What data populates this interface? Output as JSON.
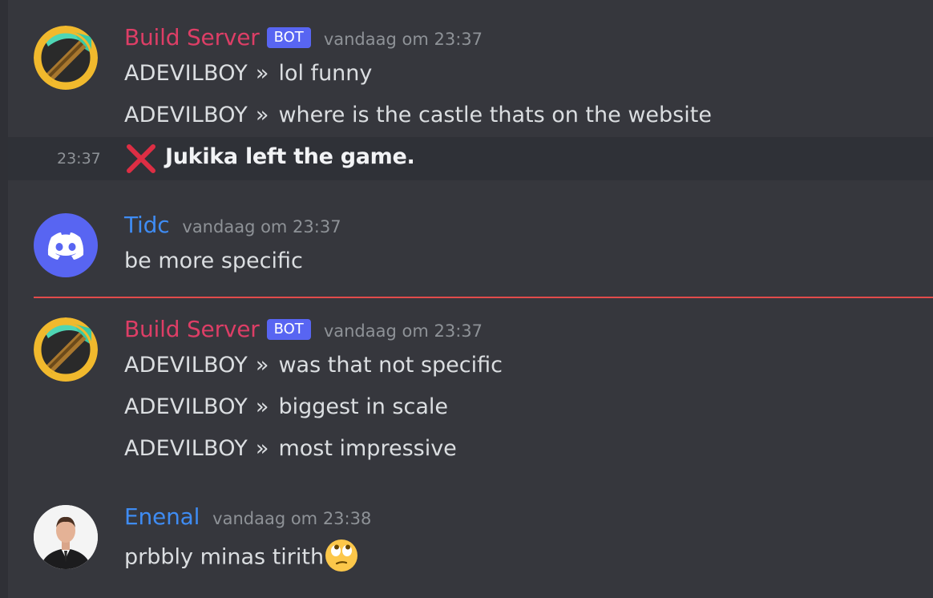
{
  "colors": {
    "background": "#36373d",
    "bot_name": "#dd3e66",
    "user_name": "#3f8cf3",
    "bot_badge": "#5865f2",
    "new_messages_divider": "#e24b4b"
  },
  "groups": [
    {
      "author": "Build Server",
      "badge": "BOT",
      "timestamp": "vandaag om 23:37",
      "avatar_icon": "pickaxe-icon",
      "lines": [
        {
          "sender": "ADEVILBOY",
          "separator": "»",
          "text": "lol funny"
        },
        {
          "sender": "ADEVILBOY",
          "separator": "»",
          "text": "where is the castle thats on the website"
        }
      ]
    },
    {
      "author": "Tidc",
      "timestamp": "vandaag om 23:37",
      "avatar_icon": "discord-logo-icon",
      "lines": [
        {
          "text": "be more specific"
        }
      ]
    },
    {
      "author": "Build Server",
      "badge": "BOT",
      "timestamp": "vandaag om 23:37",
      "avatar_icon": "pickaxe-icon",
      "lines": [
        {
          "sender": "ADEVILBOY",
          "separator": "»",
          "text": "was that not specific"
        },
        {
          "sender": "ADEVILBOY",
          "separator": "»",
          "text": "biggest in scale"
        },
        {
          "sender": "ADEVILBOY",
          "separator": "»",
          "text": "most impressive"
        }
      ]
    },
    {
      "author": "Enenal",
      "timestamp": "vandaag om 23:38",
      "avatar_icon": "person-photo-icon",
      "lines": [
        {
          "text": "prbbly minas tirith",
          "emoji": "face-with-rolling-eyes-icon"
        }
      ]
    }
  ],
  "system_message": {
    "time": "23:37",
    "icon": "red-x-icon",
    "text": "Jukika left the game."
  }
}
